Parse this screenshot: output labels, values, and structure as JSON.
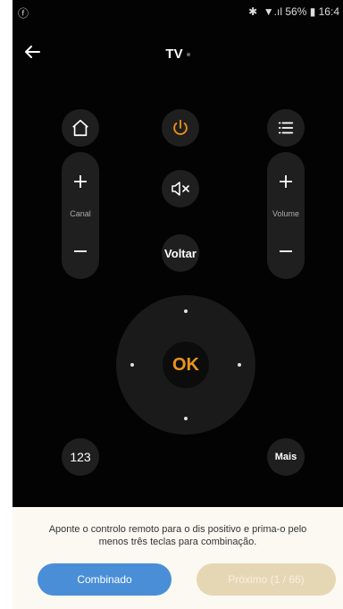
{
  "status_bar": {
    "left": "ⓕ",
    "right": "✱ ⁠ ▼.ıl 56% ▮ 16:4"
  },
  "header": {
    "title": "TV"
  },
  "remote": {
    "channel_label": "Canal",
    "volume_label": "Volume",
    "back_label": "Voltar",
    "ok_label": "OK",
    "numbers_label": "123",
    "more_label": "Mais"
  },
  "footer": {
    "instruction_line1": "Aponte o controlo remoto para o dis positivo e prima-o pelo",
    "instruction_line2": "menos três teclas para combinação.",
    "combined_label": "Combinado",
    "next_label": "Próximo (1 / 66)"
  },
  "colors": {
    "accent": "#e8951b",
    "primary_button": "#4a8ed8",
    "disabled_button": "#e6d7b4"
  }
}
